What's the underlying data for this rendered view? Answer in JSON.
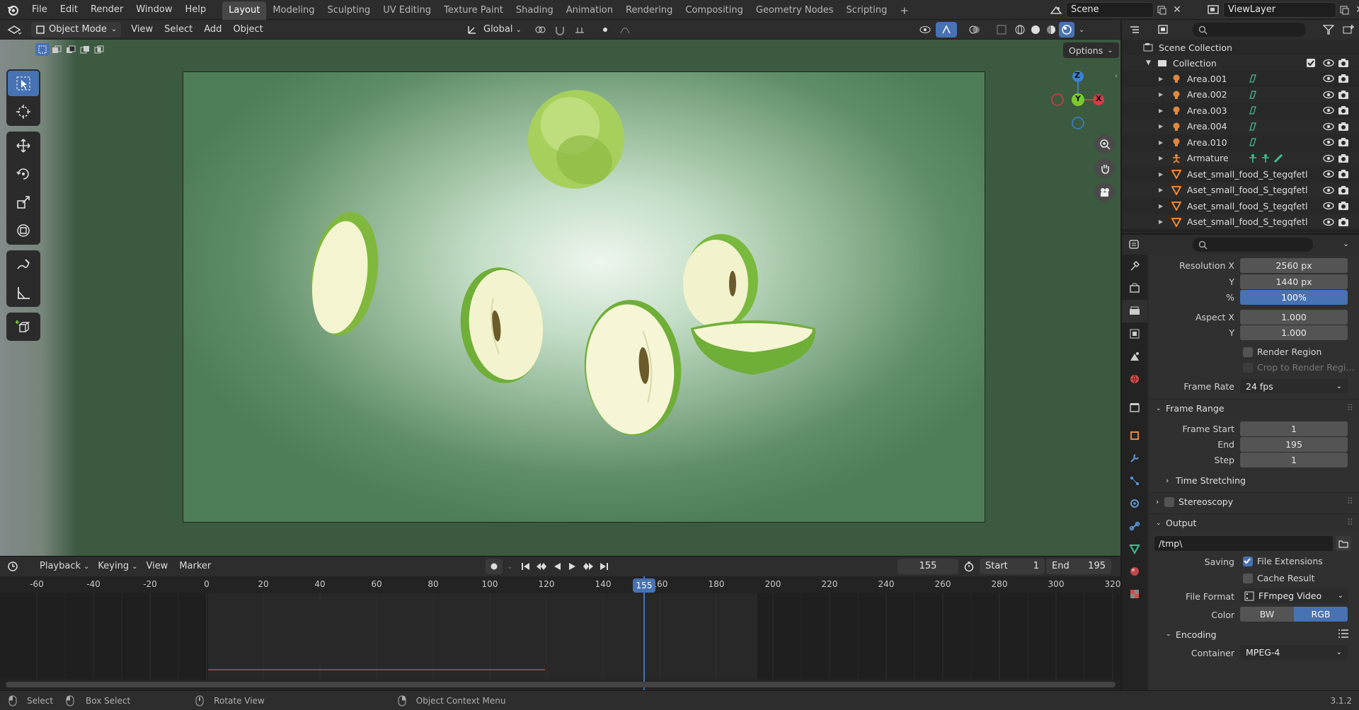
{
  "topbar": {
    "menus": [
      "File",
      "Edit",
      "Render",
      "Window",
      "Help"
    ],
    "workspaces": [
      "Layout",
      "Modeling",
      "Sculpting",
      "UV Editing",
      "Texture Paint",
      "Shading",
      "Animation",
      "Rendering",
      "Compositing",
      "Geometry Nodes",
      "Scripting"
    ],
    "active_workspace": "Layout",
    "add_workspace": "+",
    "scene": "Scene",
    "view_layer": "ViewLayer"
  },
  "viewport": {
    "mode": "Object Mode",
    "menus": [
      "View",
      "Select",
      "Add",
      "Object"
    ],
    "transform_orientation": "Global",
    "options_label": "Options",
    "gizmo": {
      "z": "Z",
      "y": "Y",
      "x": "X"
    }
  },
  "timeline": {
    "menus": [
      "Playback",
      "Keying",
      "View",
      "Marker"
    ],
    "current_frame": "155",
    "start_label": "Start",
    "start": "1",
    "end_label": "End",
    "end": "195",
    "ruler_ticks": [
      "-60",
      "-40",
      "-20",
      "0",
      "20",
      "40",
      "60",
      "80",
      "100",
      "120",
      "140",
      "160",
      "180",
      "200",
      "220",
      "240",
      "260",
      "280",
      "300",
      "320"
    ],
    "playhead_label": "155"
  },
  "status": {
    "select": "Select",
    "box_select": "Box Select",
    "rotate_view": "Rotate View",
    "context_menu": "Object Context Menu",
    "version": "3.1.2"
  },
  "outliner": {
    "scene_collection": "Scene Collection",
    "collection": "Collection",
    "items": [
      {
        "name": "Area.001",
        "type": "light"
      },
      {
        "name": "Area.002",
        "type": "light"
      },
      {
        "name": "Area.003",
        "type": "light"
      },
      {
        "name": "Area.004",
        "type": "light"
      },
      {
        "name": "Area.010",
        "type": "light"
      },
      {
        "name": "Armature",
        "type": "armature"
      },
      {
        "name": "Aset_small_food_S_tegqfetl",
        "type": "mesh"
      },
      {
        "name": "Aset_small_food_S_tegqfetl",
        "type": "mesh"
      },
      {
        "name": "Aset_small_food_S_tegqfetl",
        "type": "mesh"
      },
      {
        "name": "Aset_small_food_S_tegqfetl",
        "type": "mesh"
      }
    ]
  },
  "properties": {
    "resolution_x_label": "Resolution X",
    "resolution_x": "2560 px",
    "y_label": "Y",
    "resolution_y": "1440 px",
    "pct_label": "%",
    "resolution_pct": "100%",
    "aspect_x_label": "Aspect X",
    "aspect_x": "1.000",
    "aspect_y_label": "Y",
    "aspect_y": "1.000",
    "render_region": "Render Region",
    "crop_region": "Crop to Render Regi...",
    "frame_rate_label": "Frame Rate",
    "frame_rate": "24 fps",
    "frame_range_panel": "Frame Range",
    "frame_start_label": "Frame Start",
    "frame_start": "1",
    "end_label": "End",
    "frame_end": "195",
    "step_label": "Step",
    "frame_step": "1",
    "time_stretching": "Time Stretching",
    "stereoscopy": "Stereoscopy",
    "output_panel": "Output",
    "output_path": "/tmp\\",
    "saving_label": "Saving",
    "file_extensions": "File Extensions",
    "cache_result": "Cache Result",
    "file_format_label": "File Format",
    "file_format": "FFmpeg Video",
    "color_label": "Color",
    "color_bw": "BW",
    "color_rgb": "RGB",
    "encoding_panel": "Encoding",
    "container_label": "Container",
    "container": "MPEG-4"
  },
  "colors": {
    "accent": "#4772b3",
    "playhead": "#4772b3",
    "light_icon": "#e0893e",
    "mesh_icon": "#e8883c",
    "data_icon": "#3fbf8f",
    "gizmo_x": "#d63a48",
    "gizmo_y": "#7fc82b",
    "gizmo_z": "#3b82d6"
  }
}
